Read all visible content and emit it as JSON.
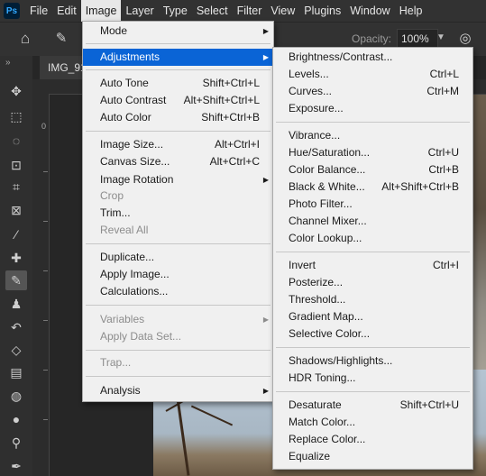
{
  "app": {
    "logo": "Ps"
  },
  "menubar": {
    "items": [
      {
        "label": "File"
      },
      {
        "label": "Edit"
      },
      {
        "label": "Image",
        "active": true
      },
      {
        "label": "Layer"
      },
      {
        "label": "Type"
      },
      {
        "label": "Select"
      },
      {
        "label": "Filter"
      },
      {
        "label": "View"
      },
      {
        "label": "Plugins"
      },
      {
        "label": "Window"
      },
      {
        "label": "Help"
      }
    ]
  },
  "options_bar": {
    "opacity_label": "Opacity:",
    "opacity_value": "100%"
  },
  "document": {
    "tab_label": "IMG_91"
  },
  "ruler": {
    "left_label": "0"
  },
  "colors": {
    "menu_bg": "#f0f0f0",
    "highlight": "#0a64d6",
    "chrome": "#323232",
    "workspace": "#262626"
  },
  "image_menu": {
    "mode": {
      "label": "Mode"
    },
    "adjustments": {
      "label": "Adjustments"
    },
    "auto_tone": {
      "label": "Auto Tone",
      "shortcut": "Shift+Ctrl+L"
    },
    "auto_contrast": {
      "label": "Auto Contrast",
      "shortcut": "Alt+Shift+Ctrl+L"
    },
    "auto_color": {
      "label": "Auto Color",
      "shortcut": "Shift+Ctrl+B"
    },
    "image_size": {
      "label": "Image Size...",
      "shortcut": "Alt+Ctrl+I"
    },
    "canvas_size": {
      "label": "Canvas Size...",
      "shortcut": "Alt+Ctrl+C"
    },
    "image_rotation": {
      "label": "Image Rotation"
    },
    "crop": {
      "label": "Crop"
    },
    "trim": {
      "label": "Trim..."
    },
    "reveal_all": {
      "label": "Reveal All"
    },
    "duplicate": {
      "label": "Duplicate..."
    },
    "apply_image": {
      "label": "Apply Image..."
    },
    "calculations": {
      "label": "Calculations..."
    },
    "variables": {
      "label": "Variables"
    },
    "apply_data_set": {
      "label": "Apply Data Set..."
    },
    "trap": {
      "label": "Trap..."
    },
    "analysis": {
      "label": "Analysis"
    }
  },
  "adjustments_menu": {
    "brightness_contrast": {
      "label": "Brightness/Contrast..."
    },
    "levels": {
      "label": "Levels...",
      "shortcut": "Ctrl+L"
    },
    "curves": {
      "label": "Curves...",
      "shortcut": "Ctrl+M"
    },
    "exposure": {
      "label": "Exposure..."
    },
    "vibrance": {
      "label": "Vibrance..."
    },
    "hue_saturation": {
      "label": "Hue/Saturation...",
      "shortcut": "Ctrl+U"
    },
    "color_balance": {
      "label": "Color Balance...",
      "shortcut": "Ctrl+B"
    },
    "black_white": {
      "label": "Black & White...",
      "shortcut": "Alt+Shift+Ctrl+B"
    },
    "photo_filter": {
      "label": "Photo Filter..."
    },
    "channel_mixer": {
      "label": "Channel Mixer..."
    },
    "color_lookup": {
      "label": "Color Lookup..."
    },
    "invert": {
      "label": "Invert",
      "shortcut": "Ctrl+I"
    },
    "posterize": {
      "label": "Posterize..."
    },
    "threshold": {
      "label": "Threshold..."
    },
    "gradient_map": {
      "label": "Gradient Map..."
    },
    "selective_color": {
      "label": "Selective Color..."
    },
    "shadows_highlights": {
      "label": "Shadows/Highlights..."
    },
    "hdr_toning": {
      "label": "HDR Toning..."
    },
    "desaturate": {
      "label": "Desaturate",
      "shortcut": "Shift+Ctrl+U"
    },
    "match_color": {
      "label": "Match Color..."
    },
    "replace_color": {
      "label": "Replace Color..."
    },
    "equalize": {
      "label": "Equalize"
    }
  }
}
